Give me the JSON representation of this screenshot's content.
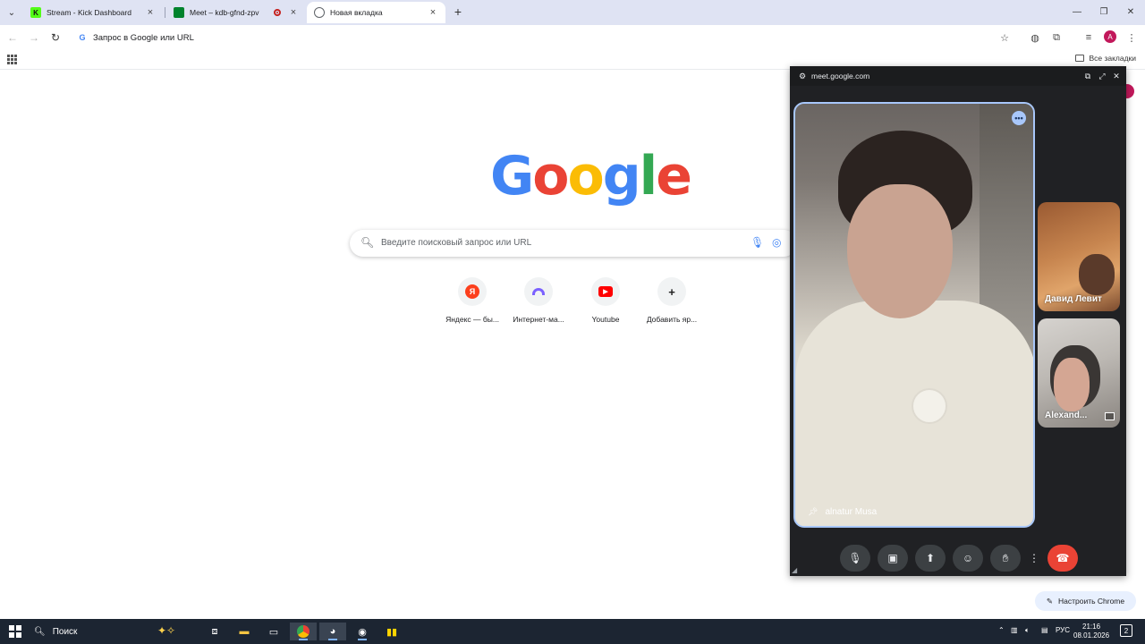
{
  "browser": {
    "tabs": [
      {
        "title": "Stream - Kick Dashboard",
        "favicon": "kick-icon",
        "active": false
      },
      {
        "title": "Meet – kdb-gfnd-zpv",
        "favicon": "meet-icon",
        "active": false,
        "recording": true
      },
      {
        "title": "Новая вкладка",
        "favicon": "chrome-icon",
        "active": true
      }
    ],
    "omnibox_placeholder": "Запрос в Google или URL",
    "all_bookmarks": "Все закладки",
    "profile_initial": "A"
  },
  "newtab": {
    "logo": [
      "G",
      "o",
      "o",
      "g",
      "l",
      "e"
    ],
    "logo_colors": [
      "#4285f4",
      "#ea4335",
      "#fbbc05",
      "#4285f4",
      "#34a853",
      "#ea4335"
    ],
    "search_placeholder": "Введите поисковый запрос или URL",
    "shortcuts": [
      {
        "label": "Яндекс — бы...",
        "icon": "Я",
        "color": "#fc3f1d"
      },
      {
        "label": "Интернет-ма...",
        "icon": "rainbow-icon",
        "color": "#7b61ff"
      },
      {
        "label": "Youtube",
        "icon": "youtube-icon",
        "color": "#ff0000"
      },
      {
        "label": "Добавить яр...",
        "icon": "+",
        "color": "#202124"
      }
    ],
    "customize_label": "Настроить Chrome"
  },
  "meet_pip": {
    "url": "meet.google.com",
    "main_participant": "alnatur Musa",
    "participants": [
      "Давид Левит",
      "Alexand..."
    ]
  },
  "taskbar": {
    "search_label": "Поиск",
    "language": "РУС",
    "time": "21:16",
    "date": "08.01.2026",
    "notifications": "2"
  }
}
